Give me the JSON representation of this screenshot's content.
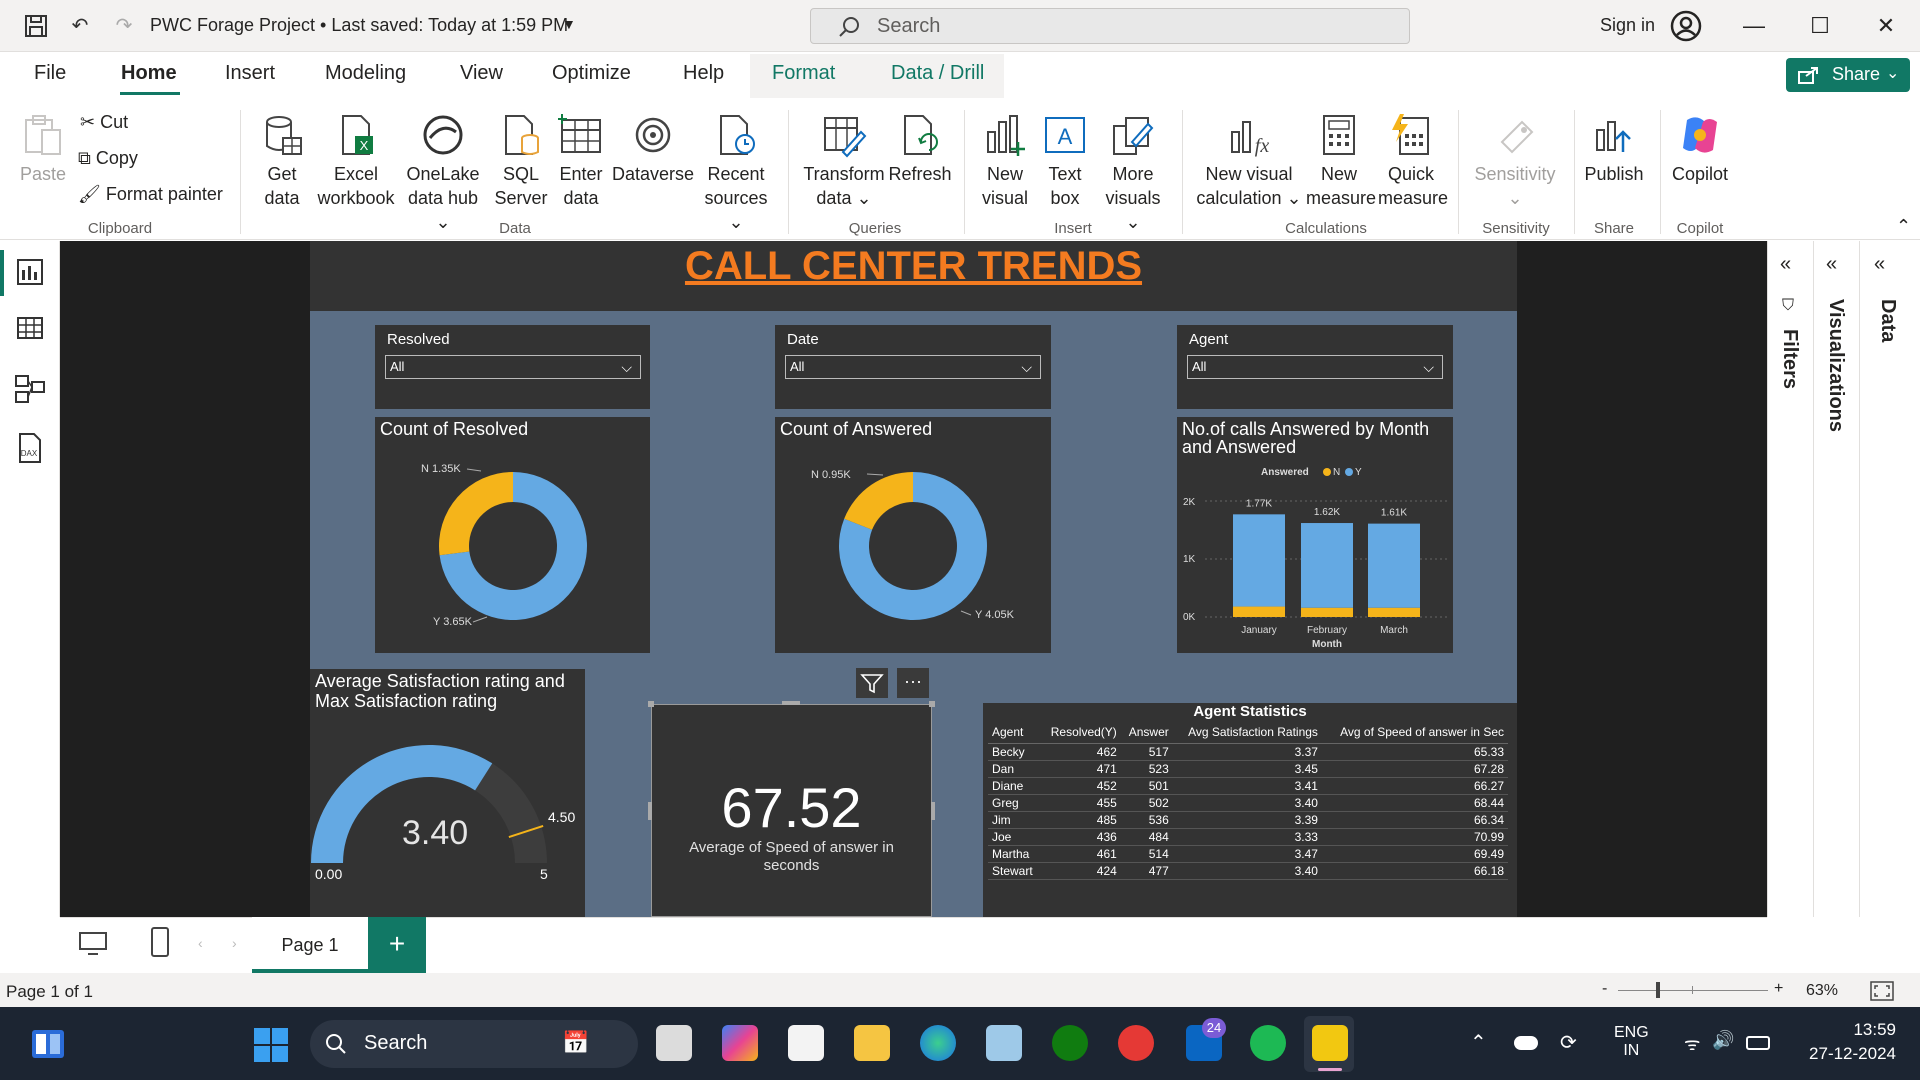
{
  "titlebar": {
    "title": "PWC Forage Project • Last saved: Today at 1:59 PM",
    "search_placeholder": "Search",
    "sign_in": "Sign in"
  },
  "menu": {
    "items": [
      "File",
      "Home",
      "Insert",
      "Modeling",
      "View",
      "Optimize",
      "Help",
      "Format",
      "Data / Drill"
    ],
    "active": "Home",
    "share": "Share"
  },
  "ribbon": {
    "clipboard": {
      "paste": "Paste",
      "cut": "Cut",
      "copy": "Copy",
      "format_painter": "Format painter",
      "label": "Clipboard"
    },
    "data": {
      "get_data": [
        "Get",
        "data"
      ],
      "excel": [
        "Excel",
        "workbook"
      ],
      "onelake": [
        "OneLake",
        "data hub"
      ],
      "sql": [
        "SQL",
        "Server"
      ],
      "enter": [
        "Enter",
        "data"
      ],
      "dataverse": "Dataverse",
      "recent": [
        "Recent",
        "sources"
      ],
      "label": "Data"
    },
    "queries": {
      "transform": [
        "Transform",
        "data"
      ],
      "refresh": "Refresh",
      "label": "Queries"
    },
    "insert": {
      "new_visual": [
        "New",
        "visual"
      ],
      "text_box": [
        "Text",
        "box"
      ],
      "more_visuals": [
        "More",
        "visuals"
      ],
      "label": "Insert"
    },
    "calculations": {
      "new_visual_calc": [
        "New visual",
        "calculation"
      ],
      "new_measure": [
        "New",
        "measure"
      ],
      "quick_measure": [
        "Quick",
        "measure"
      ],
      "label": "Calculations"
    },
    "sensitivity": {
      "btn": "Sensitivity",
      "label": "Sensitivity"
    },
    "share": {
      "publish": "Publish",
      "label": "Share"
    },
    "copilot": {
      "btn": "Copilot",
      "label": "Copilot"
    }
  },
  "report": {
    "title": "CALL CENTER TRENDS",
    "slicers": [
      {
        "title": "Resolved",
        "value": "All"
      },
      {
        "title": "Date",
        "value": "All"
      },
      {
        "title": "Agent",
        "value": "All"
      }
    ],
    "donut_resolved": {
      "title": "Count of Resolved",
      "n_label": "N 1.35K",
      "y_label": "Y 3.65K"
    },
    "donut_answered": {
      "title": "Count of Answered",
      "n_label": "N 0.95K",
      "y_label": "Y 4.05K"
    },
    "bar_chart": {
      "title_line1": "No.of calls Answered by Month",
      "title_line2": "and Answered",
      "legend_title": "Answered",
      "legend_n": "N",
      "legend_y": "Y",
      "y_ticks": [
        "2K",
        "1K",
        "0K"
      ],
      "xlabel": "Month",
      "data_labels": [
        "1.77K",
        "1.62K",
        "1.61K"
      ]
    },
    "gauge": {
      "title_line1": "Average Satisfaction rating and",
      "title_line2": "Max Satisfaction rating",
      "value_label": "3.40",
      "min_label": "0.00",
      "max_label": "5",
      "target_label": "4.50"
    },
    "kpi": {
      "value": "67.52",
      "caption_line1": "Average of Speed of answer in",
      "caption_line2": "seconds"
    },
    "table": {
      "title": "Agent Statistics",
      "headers": [
        "Agent",
        "Resolved(Y)",
        "Answer",
        "Avg Satisfaction Ratings",
        "Avg of Speed of answer in Sec"
      ],
      "rows": [
        [
          "Becky",
          "462",
          "517",
          "3.37",
          "65.33"
        ],
        [
          "Dan",
          "471",
          "523",
          "3.45",
          "67.28"
        ],
        [
          "Diane",
          "452",
          "501",
          "3.41",
          "66.27"
        ],
        [
          "Greg",
          "455",
          "502",
          "3.40",
          "68.44"
        ],
        [
          "Jim",
          "485",
          "536",
          "3.39",
          "66.34"
        ],
        [
          "Joe",
          "436",
          "484",
          "3.33",
          "70.99"
        ],
        [
          "Martha",
          "461",
          "514",
          "3.47",
          "69.49"
        ],
        [
          "Stewart",
          "424",
          "477",
          "3.40",
          "66.18"
        ]
      ]
    }
  },
  "chart_data": [
    {
      "type": "pie",
      "title": "Count of Resolved",
      "categories": [
        "N",
        "Y"
      ],
      "values": [
        1350,
        3650
      ],
      "colors": [
        "#f5b41a",
        "#64a9e3"
      ]
    },
    {
      "type": "pie",
      "title": "Count of Answered",
      "categories": [
        "N",
        "Y"
      ],
      "values": [
        950,
        4050
      ],
      "colors": [
        "#f5b41a",
        "#64a9e3"
      ]
    },
    {
      "type": "bar",
      "title": "No.of calls Answered by Month and Answered",
      "categories": [
        "January",
        "February",
        "March"
      ],
      "xlabel": "Month",
      "ylim": [
        0,
        2000
      ],
      "stacked": true,
      "legend": "top",
      "series": [
        {
          "name": "N",
          "values": [
            180,
            160,
            160
          ],
          "color": "#f5b41a"
        },
        {
          "name": "Y",
          "values": [
            1590,
            1460,
            1450
          ],
          "color": "#64a9e3"
        }
      ],
      "totals": [
        1770,
        1620,
        1610
      ]
    },
    {
      "type": "gauge",
      "value": 3.4,
      "min": 0,
      "max": 5,
      "target": 4.5
    }
  ],
  "panes": {
    "filters": "Filters",
    "visualizations": "Visualizations",
    "data": "Data"
  },
  "tabs": {
    "page": "Page 1",
    "add": "+"
  },
  "status": {
    "page": "Page 1 of 1",
    "zoom": "63%"
  },
  "taskbar": {
    "search": "Search",
    "lang1": "ENG",
    "lang2": "IN",
    "time": "13:59",
    "date": "27-12-2024",
    "badge": "24"
  },
  "colors": {
    "accent": "#117865",
    "title_orange": "#f47b20",
    "series_n": "#f5b41a",
    "series_y": "#64a9e3",
    "page_bg": "#5b6e85",
    "card_bg": "#333333"
  }
}
